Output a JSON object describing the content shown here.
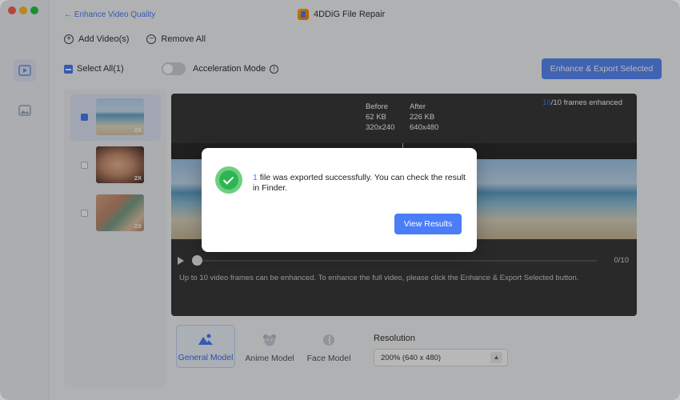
{
  "window": {
    "title": "4DDiG File Repair"
  },
  "nav": {
    "back_label": "← Enhance Video Quality"
  },
  "toolbar": {
    "add_label": "Add Video(s)",
    "remove_label": "Remove All",
    "select_all_label": "Select All(1)",
    "acceleration_label": "Acceleration Mode",
    "export_label": "Enhance & Export Selected"
  },
  "thumbnails": [
    {
      "badge": "2X",
      "checked": true
    },
    {
      "badge": "2X",
      "checked": false
    },
    {
      "badge": "2X",
      "checked": false
    }
  ],
  "preview": {
    "before_label": "Before",
    "before_size": "62 KB",
    "before_res": "320x240",
    "after_label": "After",
    "after_size": "226 KB",
    "after_res": "640x480",
    "frames_done": "10",
    "frames_suffix": "/10 frames enhanced",
    "frame_counter": "0/10",
    "note": "Up to 10 video frames can be enhanced. To enhance the full video, please click the Enhance & Export Selected button."
  },
  "models": {
    "general": "General Model",
    "anime": "Anime Model",
    "face": "Face Model",
    "resolution_label": "Resolution",
    "resolution_value": "200% (640 x 480)"
  },
  "modal": {
    "count": "1",
    "message": " file was exported successfully. You can check the result in Finder.",
    "button_label": "View Results"
  },
  "colors": {
    "accent": "#4a7df7",
    "success": "#2db552"
  }
}
